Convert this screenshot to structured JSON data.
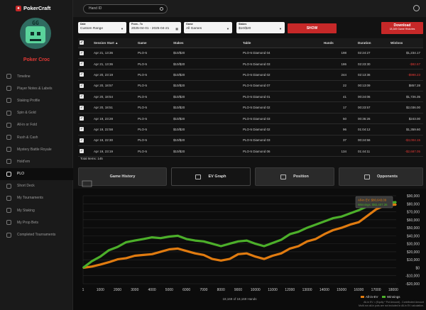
{
  "app": {
    "logo_text": "PokerCraft"
  },
  "user": {
    "avatar_text": "GG",
    "name": "Poker Croc"
  },
  "sidebar": {
    "items": [
      {
        "label": "Timeline",
        "icon": "timeline-icon",
        "active": false
      },
      {
        "label": "Player Notes & Labels",
        "icon": "notes-icon",
        "active": false
      },
      {
        "label": "Staking Profile",
        "icon": "staking-icon",
        "active": false
      },
      {
        "label": "Spin & Gold",
        "icon": "spin-icon",
        "active": false
      },
      {
        "label": "All-in or Fold",
        "icon": "allin-icon",
        "active": false
      },
      {
        "label": "Rush & Cash",
        "icon": "rush-icon",
        "active": false
      },
      {
        "label": "Mystery Battle Royale",
        "icon": "mystery-icon",
        "active": false
      },
      {
        "label": "Hold'em",
        "icon": "holdem-icon",
        "active": false
      },
      {
        "label": "PLO",
        "icon": "plo-icon",
        "active": true
      },
      {
        "label": "Short Deck",
        "icon": "shortdeck-icon",
        "active": false
      },
      {
        "label": "My Tournaments",
        "icon": "trophy-icon",
        "active": false
      },
      {
        "label": "My Staking",
        "icon": "staking-icon",
        "active": false
      },
      {
        "label": "My Prop Bets",
        "icon": "propbet-icon",
        "active": false
      },
      {
        "label": "Completed Tournaments",
        "icon": "completed-icon",
        "active": false
      }
    ]
  },
  "search": {
    "value": "Hand ID"
  },
  "filters": {
    "date": {
      "label": "Date",
      "value": "Custom Range"
    },
    "fromto": {
      "label": "From - To",
      "value": "2025-04-01 - 2025-04-21"
    },
    "game": {
      "label": "Game",
      "value": "All Games"
    },
    "stakes": {
      "label": "Stakes",
      "value": "$10/$20"
    },
    "show_label": "SHOW",
    "download_label": "Download",
    "download_sub": "18,169 Game Histories"
  },
  "table": {
    "headers": [
      "Session Start ▲",
      "Game",
      "Stakes",
      "Table",
      "Hands",
      "Duration",
      "Winloss"
    ],
    "rows": [
      {
        "start": "Apr 21, 13:36",
        "game": "PLO-5",
        "stakes": "$10/$20",
        "table": "PLO-5 Diamond 04",
        "hands": "198",
        "duration": "02:24:27",
        "winloss": "$1,234.17"
      },
      {
        "start": "Apr 21, 13:36",
        "game": "PLO-5",
        "stakes": "$10/$20",
        "table": "PLO-5 Diamond 03",
        "hands": "186",
        "duration": "02:23:30",
        "winloss": "-$82.67"
      },
      {
        "start": "Apr 20, 23:19",
        "game": "PLO-5",
        "stakes": "$10/$20",
        "table": "PLO-5 Diamond 02",
        "hands": "244",
        "duration": "02:13:36",
        "winloss": "-$998.23"
      },
      {
        "start": "Apr 20, 18:57",
        "game": "PLO-5",
        "stakes": "$10/$20",
        "table": "PLO-5 Diamond 07",
        "hands": "22",
        "duration": "00:13:09",
        "winloss": "$857.28"
      },
      {
        "start": "Apr 20, 18:54",
        "game": "PLO-5",
        "stakes": "$10/$20",
        "table": "PLO-5 Diamond 01",
        "hands": "41",
        "duration": "00:24:06",
        "winloss": "$1,726.35"
      },
      {
        "start": "Apr 20, 18:51",
        "game": "PLO-5",
        "stakes": "$10/$20",
        "table": "PLO-5 Diamond 02",
        "hands": "17",
        "duration": "00:23:57",
        "winloss": "$2,036.00"
      },
      {
        "start": "Apr 19, 23:28",
        "game": "PLO-5",
        "stakes": "$10/$20",
        "table": "PLO-5 Diamond 03",
        "hands": "50",
        "duration": "00:36:26",
        "winloss": "$243.00"
      },
      {
        "start": "Apr 19, 22:58",
        "game": "PLO-5",
        "stakes": "$10/$20",
        "table": "PLO-5 Diamond 02",
        "hands": "96",
        "duration": "01:04:12",
        "winloss": "$1,359.60"
      },
      {
        "start": "Apr 19, 22:30",
        "game": "PLO-5",
        "stakes": "$10/$20",
        "table": "PLO-5 Diamond 03",
        "hands": "37",
        "duration": "00:24:56",
        "winloss": "-$3,004.15"
      },
      {
        "start": "Apr 19, 23:19",
        "game": "PLO-5",
        "stakes": "$10/$20",
        "table": "PLO-5 Diamond 06",
        "hands": "134",
        "duration": "01:44:11",
        "winloss": "-$2,687.05"
      }
    ],
    "total_label": "Total Items: 145"
  },
  "tabs": [
    {
      "label": "Game History",
      "icon": "history-icon",
      "active": false
    },
    {
      "label": "EV Graph",
      "icon": "graph-icon",
      "active": true
    },
    {
      "label": "Position",
      "icon": "position-icon",
      "active": false
    },
    {
      "label": "Opponents",
      "icon": "opponents-icon",
      "active": false
    }
  ],
  "colors": {
    "accent": "#c62828",
    "winnings": "#4caf2a",
    "allin_ev": "#e07b10",
    "negative": "#e53935"
  },
  "chart_data": {
    "type": "line",
    "x_ticks": [
      1000,
      2000,
      3000,
      4000,
      5000,
      6000,
      7000,
      8000,
      9000,
      10000,
      11000,
      12000,
      13000,
      14000,
      15000,
      16000,
      17000,
      18000
    ],
    "x_first_label": "1",
    "y_ticks": [
      "-$20,000",
      "-$10,000",
      "$0",
      "$10,000",
      "$20,000",
      "$30,000",
      "$40,000",
      "$50,000",
      "$60,000",
      "$70,000",
      "$80,000",
      "$90,000"
    ],
    "y_values": [
      -20000,
      -10000,
      0,
      10000,
      20000,
      30000,
      40000,
      50000,
      60000,
      70000,
      80000,
      90000
    ],
    "ylim": [
      -20000,
      90000
    ],
    "xlim": [
      0,
      18169
    ],
    "xlabel": "18,169 of 18,169 Hands",
    "series": [
      {
        "name": "All-in-EV",
        "color": "#e07b10",
        "x": [
          0,
          500,
          1000,
          1500,
          2000,
          2500,
          3000,
          3500,
          4000,
          4500,
          5000,
          5500,
          6000,
          6500,
          7000,
          7500,
          8000,
          8500,
          9000,
          9500,
          10000,
          10500,
          11000,
          11500,
          12000,
          12500,
          13000,
          13500,
          14000,
          14500,
          15000,
          15500,
          16000,
          16500,
          17000,
          17500,
          18169
        ],
        "y": [
          0,
          1500,
          4000,
          7000,
          10500,
          12000,
          15000,
          16000,
          17000,
          20000,
          23000,
          24000,
          21000,
          18000,
          16000,
          11000,
          9000,
          11000,
          17000,
          18000,
          14000,
          11000,
          15000,
          18000,
          24000,
          27000,
          33000,
          36000,
          42000,
          47000,
          50000,
          54000,
          57000,
          65000,
          73000,
          78000,
          79000
        ]
      },
      {
        "name": "Winnings",
        "color": "#4caf2a",
        "x": [
          0,
          500,
          1000,
          1500,
          2000,
          2500,
          3000,
          3500,
          4000,
          4500,
          5000,
          5500,
          6000,
          6500,
          7000,
          7500,
          8000,
          8500,
          9000,
          9500,
          10000,
          10500,
          11000,
          11500,
          12000,
          12500,
          13000,
          13500,
          14000,
          14500,
          15000,
          15500,
          16000,
          16500,
          17000,
          17500,
          18169
        ],
        "y": [
          0,
          8000,
          14000,
          22000,
          26000,
          32000,
          34000,
          36000,
          38000,
          37000,
          39000,
          40000,
          36000,
          34000,
          33000,
          30000,
          27000,
          30000,
          33000,
          34000,
          30000,
          27000,
          31000,
          35000,
          42000,
          45000,
          50000,
          54000,
          58000,
          62000,
          64000,
          68000,
          72000,
          77000,
          80000,
          81000,
          82000
        ]
      }
    ],
    "hover_tooltip": {
      "label1": "All-in EV: $80,643.09",
      "label2": "Winnings: $82,407.36"
    },
    "legend": [
      {
        "label": "All-in-EV"
      },
      {
        "label": "Winnings"
      }
    ],
    "legend_position": "bottom-right",
    "footnote1": "All-in EV = (Equity * Pot Amount) - Contributed Amount",
    "footnote2": "Multi-run all-in pots are not included in All-in EV calculation."
  }
}
